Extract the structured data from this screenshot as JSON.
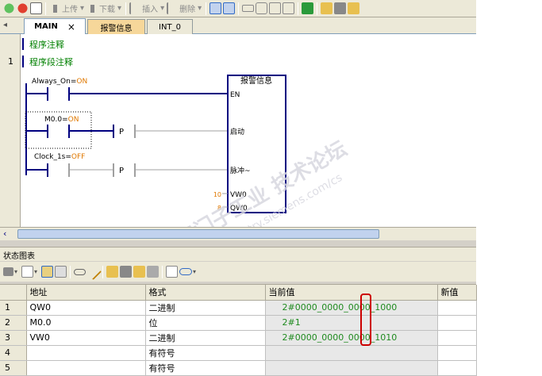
{
  "toolbar": {
    "upload_label": "上传",
    "download_label": "下载",
    "insert_label": "插入",
    "delete_label": "删除"
  },
  "tabs": [
    {
      "label": "MAIN"
    },
    {
      "label": "报警信息"
    },
    {
      "label": "INT_0"
    }
  ],
  "tab_close_glyph": "×",
  "editor": {
    "program_comment": "程序注释",
    "network_number": "1",
    "network_comment": "程序段注释",
    "contacts": {
      "always_on_name": "Always_On",
      "always_on_state": "ON",
      "m00_name": "M0.0",
      "m00_state": "ON",
      "clock_name": "Clock_1s",
      "clock_state": "OFF",
      "p_label_1": "P",
      "p_label_2": "P",
      "eq": "="
    },
    "block": {
      "title": "报警信息",
      "pin_en": "EN",
      "pin_start": "启动",
      "pin_pulse": "脉冲~",
      "pin_vw0": "VW0",
      "pin_qw0": "QW0",
      "vw0_value": "10",
      "qw0_value": "8"
    },
    "watermark": {
      "line1": "西门子工业  技术论坛",
      "line2": "support.industry.siemens.com/cs"
    }
  },
  "status_chart": {
    "title": "状态图表",
    "columns": [
      "",
      "地址",
      "格式",
      "当前值",
      "新值"
    ],
    "rows": [
      {
        "n": "1",
        "address": "QW0",
        "format": "二进制",
        "current": "2#0000_0000_0000_1000",
        "new": ""
      },
      {
        "n": "2",
        "address": "M0.0",
        "format": "位",
        "current": "2#1",
        "new": ""
      },
      {
        "n": "3",
        "address": "VW0",
        "format": "二进制",
        "current": "2#0000_0000_0000_1010",
        "new": ""
      },
      {
        "n": "4",
        "address": "",
        "format": "有符号",
        "current": "",
        "new": ""
      },
      {
        "n": "5",
        "address": "",
        "format": "有符号",
        "current": "",
        "new": ""
      }
    ]
  },
  "colors": {
    "energized": "#000080",
    "unpowered": "#a0a0a0",
    "value_green": "#1e8a1e",
    "state_orange": "#e07800",
    "highlight_red": "#cc0000",
    "tab_orange": "#f6d79a"
  }
}
